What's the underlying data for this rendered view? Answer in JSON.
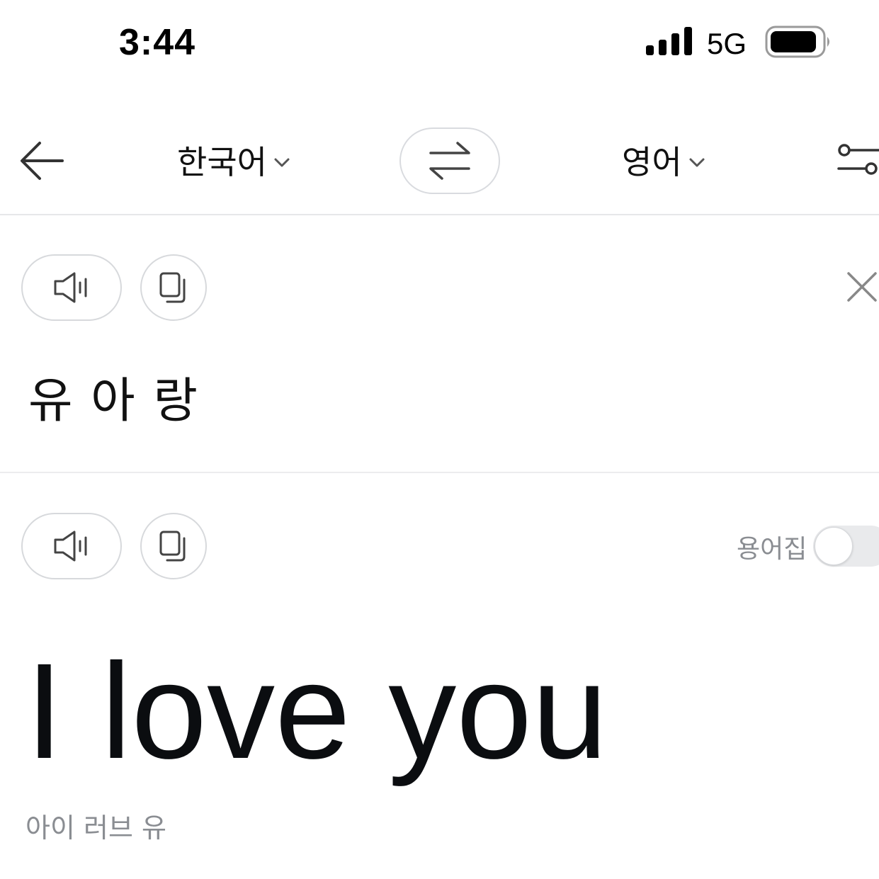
{
  "status_bar": {
    "time": "3:44",
    "network": "5G",
    "signal_icon": "cellular-signal-icon",
    "battery_icon": "battery-icon"
  },
  "toolbar": {
    "back_icon": "arrow-left-icon",
    "source_language": "한국어",
    "target_language": "영어",
    "swap_icon": "swap-arrows-icon",
    "settings_icon": "sliders-icon"
  },
  "source": {
    "text": "유 아 랑",
    "speak_icon": "speaker-icon",
    "copy_icon": "copy-icon",
    "clear_icon": "close-icon"
  },
  "result": {
    "text": "I love you",
    "pronunciation": "아이 러브 유",
    "glossary_label": "용어집",
    "glossary_enabled": false,
    "speak_icon": "speaker-icon",
    "copy_icon": "copy-icon"
  },
  "colors": {
    "text_primary": "#0b0d10",
    "text_secondary": "#8a8d92",
    "border": "#d7d9dc",
    "toggle_off": "#e9eaec"
  }
}
